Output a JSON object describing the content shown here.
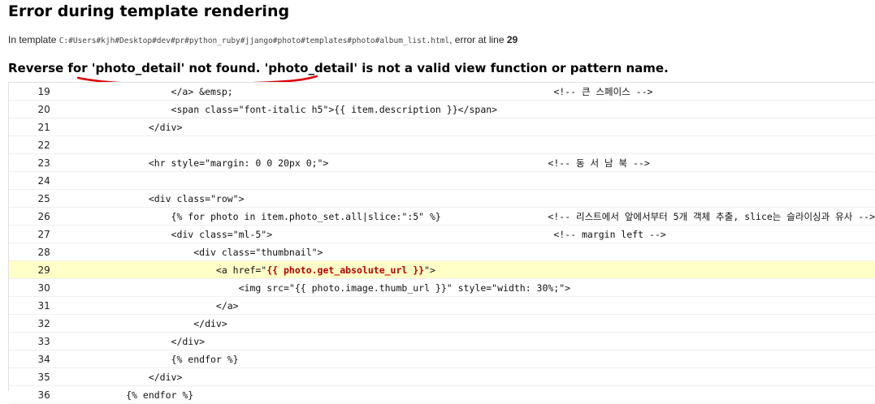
{
  "header": {
    "title": "Error during template rendering",
    "template_prefix": "In template ",
    "template_path": "C:#Users#kjh#Desktop#dev#pr#python_ruby#jjango#photo#templates#photo#album_list.html",
    "error_at_prefix": ", error at line ",
    "error_line": "29"
  },
  "error": {
    "message": "Reverse for 'photo_detail' not found. 'photo_detail' is not a valid view function or pattern name."
  },
  "source": {
    "lines": [
      {
        "n": "19",
        "code": "                </a> &emsp;                                                         <!-- 큰 스페이스 -->"
      },
      {
        "n": "20",
        "code": "                <span class=\"font-italic h5\">{{ item.description }}</span>"
      },
      {
        "n": "21",
        "code": "            </div>"
      },
      {
        "n": "22",
        "code": ""
      },
      {
        "n": "23",
        "code": "            <hr style=\"margin: 0 0 20px 0;\">                                       <!-- 동 서 남 북 -->"
      },
      {
        "n": "24",
        "code": ""
      },
      {
        "n": "25",
        "code": "            <div class=\"row\">"
      },
      {
        "n": "26",
        "code": "                {% for photo in item.photo_set.all|slice:\":5\" %}                   <!-- 리스트에서 앞에서부터 5개 객체 추출, slice는 슬라이싱과 유사 -->"
      },
      {
        "n": "27",
        "code": "                <div class=\"ml-5\">                                                  <!-- margin left -->"
      },
      {
        "n": "28",
        "code": "                    <div class=\"thumbnail\">"
      },
      {
        "n": "29",
        "code_before": "                        <a href=\"",
        "code_hl": "{{ photo.get_absolute_url }}",
        "code_after": "\">"
      },
      {
        "n": "30",
        "code": "                            <img src=\"{{ photo.image.thumb_url }}\" style=\"width: 30%;\">"
      },
      {
        "n": "31",
        "code": "                        </a>"
      },
      {
        "n": "32",
        "code": "                    </div>"
      },
      {
        "n": "33",
        "code": "                </div>"
      },
      {
        "n": "34",
        "code": "                {% endfor %}"
      },
      {
        "n": "35",
        "code": "            </div>"
      },
      {
        "n": "36",
        "code": "        {% endfor %}"
      }
    ]
  },
  "colors": {
    "highlight_bg": "#ffffc8",
    "highlight_text": "#bb0000",
    "annotation_red": "#e00000"
  }
}
